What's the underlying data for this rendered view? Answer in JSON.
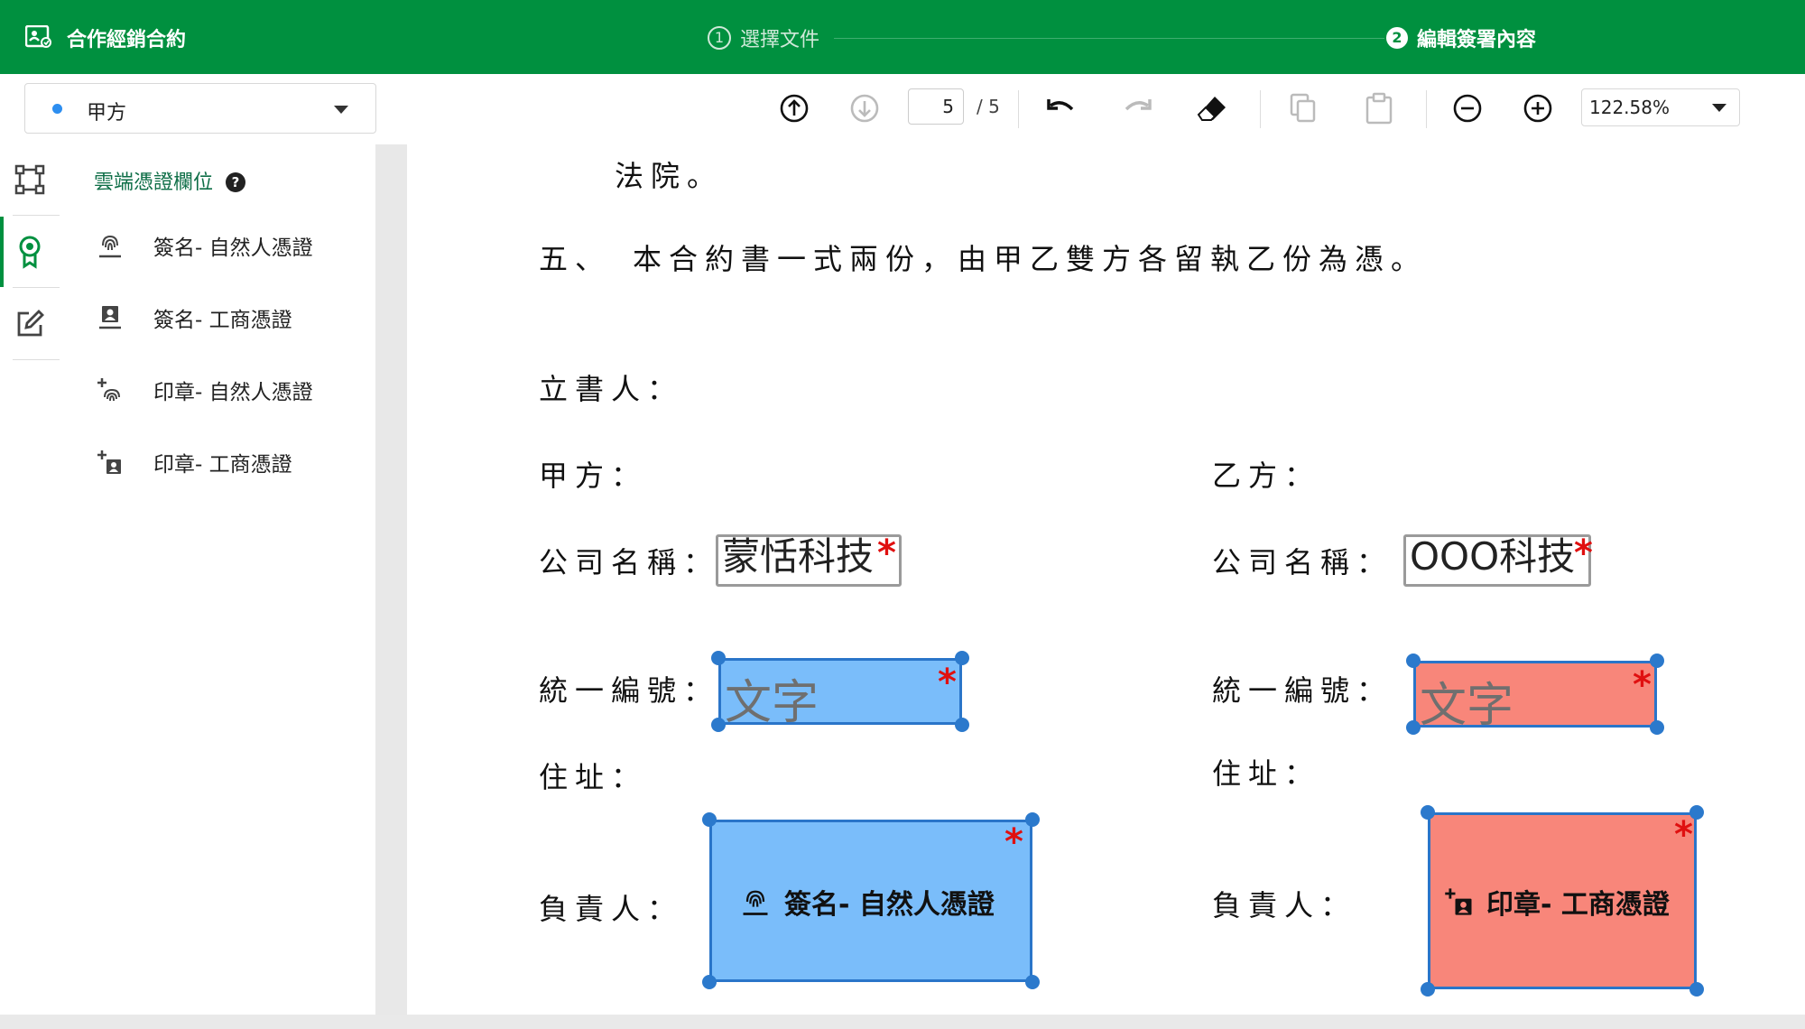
{
  "header": {
    "title": "合作經銷合約",
    "steps": [
      {
        "num": "1",
        "label": "選擇文件"
      },
      {
        "num": "2",
        "label": "編輯簽署內容"
      }
    ],
    "accent": "#00903f"
  },
  "toolbar": {
    "party": "甲方",
    "page_current": "5",
    "page_total": "/ 5",
    "zoom": "122.58%"
  },
  "panel": {
    "title": "雲端憑證欄位",
    "items": [
      {
        "label": "簽名- 自然人憑證",
        "icon": "fingerprint-icon"
      },
      {
        "label": "簽名- 工商憑證",
        "icon": "badge-icon"
      },
      {
        "label": "印章- 自然人憑證",
        "icon": "stamp-fingerprint-icon"
      },
      {
        "label": "印章- 工商憑證",
        "icon": "stamp-badge-icon"
      }
    ]
  },
  "document": {
    "line_court": "法院。",
    "clause_five": "五、　本合約書一式兩份，由甲乙雙方各留執乙份為憑。",
    "signers_label": "立書人：",
    "party_a": "甲方：",
    "party_b": "乙方：",
    "company_label": "公司名稱：",
    "tax_id_label": "統一編號：",
    "address_label": "住址：",
    "owner_label": "負責人：",
    "company_a_value": "蒙恬科技",
    "company_b_value": "OOO科技",
    "text_placeholder": "文字",
    "sig_a_label": "簽名- 自然人憑證",
    "sig_b_label": "印章- 工商憑證",
    "required_mark": "*"
  },
  "colors": {
    "party_a_field": "#7abdfa",
    "party_b_field": "#f8867a",
    "handle": "#2b79cc",
    "required": "#e01010"
  }
}
